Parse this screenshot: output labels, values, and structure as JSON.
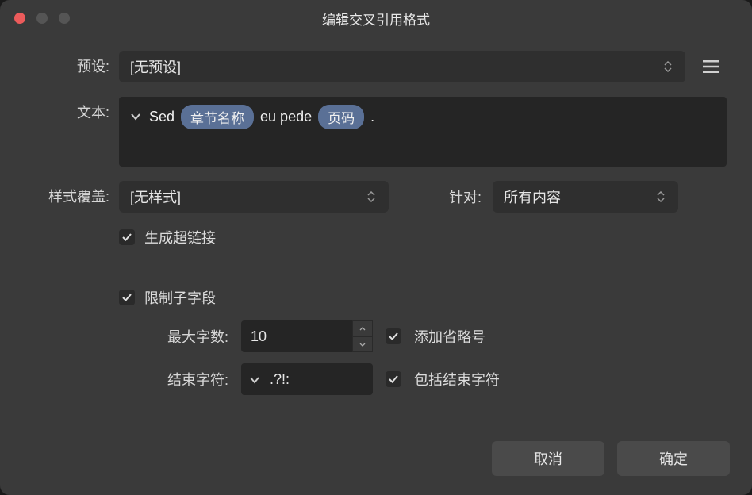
{
  "window": {
    "title": "编辑交叉引用格式"
  },
  "labels": {
    "preset": "预设:",
    "text": "文本:",
    "styleOverride": "样式覆盖:",
    "target": "针对:",
    "maxChars": "最大字数:",
    "endChars": "结束字符:"
  },
  "preset": {
    "value": "[无预设]"
  },
  "textField": {
    "parts": {
      "p0": "Sed",
      "token1": "章节名称",
      "p1": "eu pede",
      "token2": "页码",
      "p2": "."
    }
  },
  "styleOverride": {
    "value": "[无样式]"
  },
  "target": {
    "value": "所有内容"
  },
  "checkboxes": {
    "hyperlink": "生成超链接",
    "limitSubfields": "限制子字段",
    "addEllipsis": "添加省略号",
    "includeEndChars": "包括结束字符"
  },
  "maxChars": {
    "value": "10"
  },
  "endChars": {
    "value": ".?!:"
  },
  "buttons": {
    "cancel": "取消",
    "ok": "确定"
  }
}
